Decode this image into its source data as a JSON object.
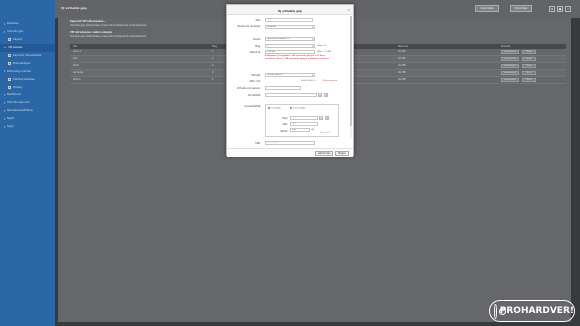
{
  "window": {
    "title": "Új virtuális gép"
  },
  "sidebar": {
    "items": [
      {
        "label": "Kezdőlap",
        "level": 0
      },
      {
        "label": "Virtuális gép",
        "level": 0
      },
      {
        "label": "Állapot",
        "level": 1
      },
      {
        "label": "VM-kezelés",
        "level": 0,
        "active": true
      },
      {
        "label": "Kapcsolt VM-eszközök",
        "level": 1
      },
      {
        "label": "Pillanatképek",
        "level": 1
      },
      {
        "label": "Biztonsági mentés",
        "level": 0
      },
      {
        "label": "Hálózat kezelése",
        "level": 1
      },
      {
        "label": "Tárhely",
        "level": 1
      },
      {
        "label": "Beállítások",
        "level": 0
      },
      {
        "label": "Virtuális kapcsoló",
        "level": 0
      },
      {
        "label": "Rendszerbeállítások",
        "level": 0
      },
      {
        "label": "Napló",
        "level": 0
      },
      {
        "label": "Súgó",
        "level": 0
      }
    ]
  },
  "toolbar": {
    "btn1": "Importálás",
    "btn2": "Exportálás",
    "icons": [
      "gear-icon",
      "user-icon",
      "help-icon"
    ]
  },
  "description": {
    "line1": "Kapcsolt VM létrehozása...",
    "line2": "Virtuális gép létrehozása a kapcsolt konfiguráció módosításával.",
    "line3": "VM létrehozása: sablon alapján",
    "line4": "Virtuális gép létrehozása a kapcsolt konfiguráció módosításával."
  },
  "table": {
    "headers": [
      "Név",
      "Mag",
      "Memória",
      "Művelet"
    ],
    "rows": [
      {
        "name": "alma-1",
        "cores": "1",
        "memory": "2G MB"
      },
      {
        "name": "test",
        "cores": "1",
        "memory": "2G MB"
      },
      {
        "name": "test2",
        "cores": "2",
        "memory": "2G MB"
      },
      {
        "name": "windows",
        "cores": "2",
        "memory": "4G MB"
      },
      {
        "name": "fedora",
        "cores": "2",
        "memory": "2G MB"
      }
    ],
    "edit_label": "Szerkesztés",
    "delete_label": "Törlés"
  },
  "form": {
    "name_label": "Név:",
    "name_placeholder": "Név",
    "os_label": "Operációs rendszer:",
    "os_value": "Windows",
    "version_label": "Verzió:",
    "version_value": "Microsoft Windows 10",
    "cores_label": "Mag:",
    "cores_value": "1",
    "cores_max": "(Max: 4)",
    "memory_label": "Memória:",
    "memory_value": "128 MB",
    "memory_max": "(Max: 7.7 GB)",
    "memory_error": "A Windows 10 legalább 1 GB memóriát igényel a 32 bites verzióhoz, illetve 2 GB memóriát igényel a 64 bites verzióhoz.",
    "vswitch_label": "Hálózat:",
    "vswitch_value": "Virtual Switch 1",
    "mac_label": "MAC-cím:",
    "mac_value": "00:0C:29:F3:...",
    "mac_link": "Véletlenszerű",
    "cpu_label": "Virtuális processzor:",
    "cd_label": "CD-képfájl:",
    "disk_label": "Lemezképfájl:",
    "radio_new": "Új képfájl",
    "radio_existing": "Kész képfájl",
    "location_label": "Hely:",
    "name2_label": "Név:",
    "name2_placeholder": "Név",
    "size_label": "Méret:",
    "size_value": "100",
    "size_unit": "GB",
    "size_max": "Max: 999",
    "vnc_label": "VNC:",
    "vnc_placeholder": "VNC-jelszó",
    "create_label": "Létrehozás",
    "cancel_label": "Mégse"
  },
  "watermark": {
    "text": "PROHARDVER!"
  },
  "colors": {
    "sidebar": "#2f6fb6",
    "error": "#d0021b",
    "modal_bg": "#ffffff"
  }
}
